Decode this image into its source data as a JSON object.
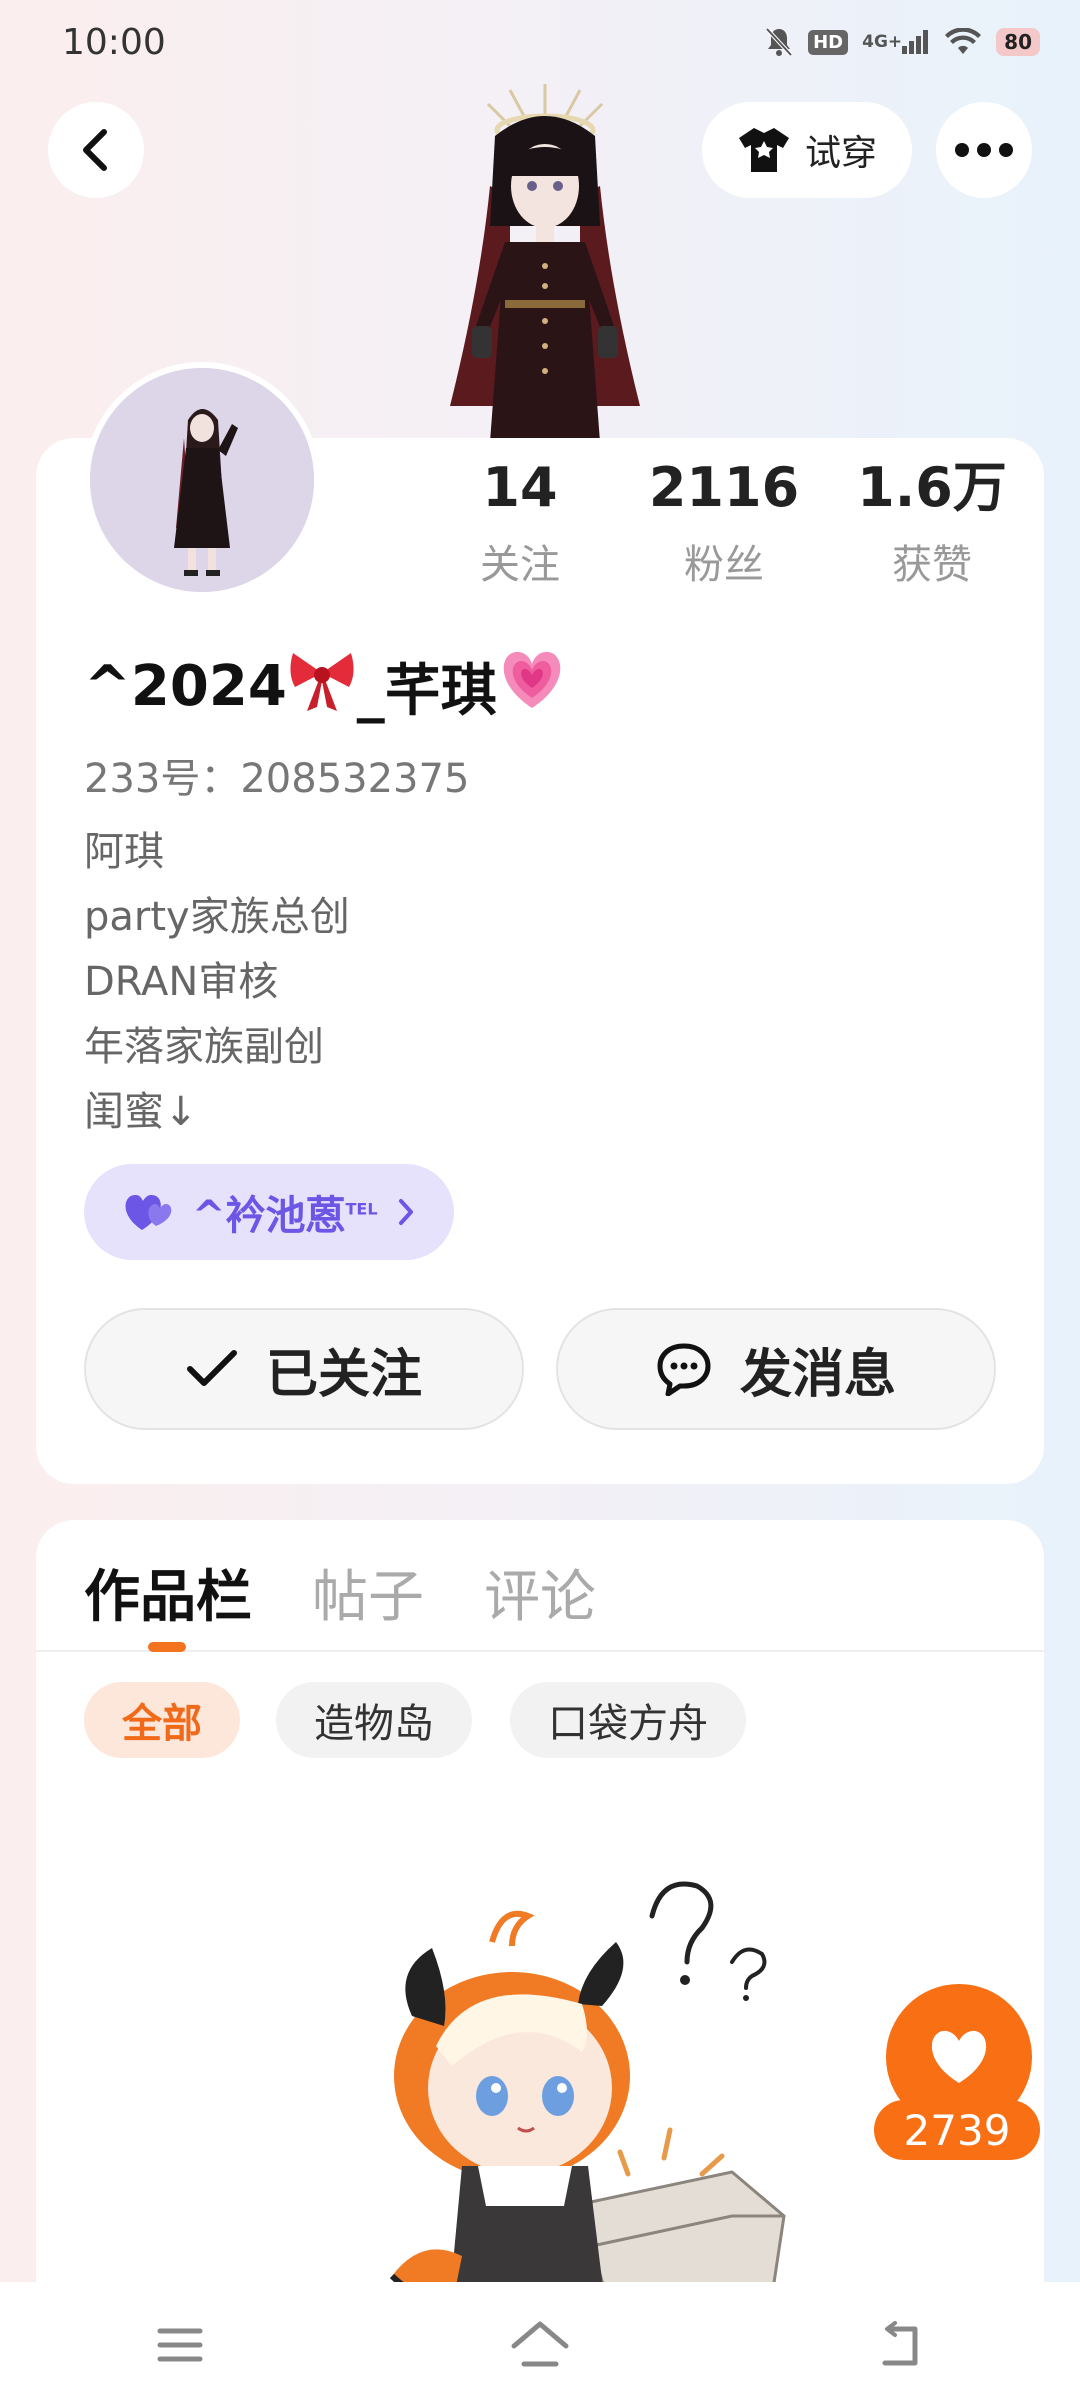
{
  "status_bar": {
    "time": "10:00",
    "hd": "HD",
    "network": "4G+",
    "battery": "80"
  },
  "header": {
    "try_on_label": "试穿"
  },
  "stats": [
    {
      "value": "14",
      "label": "关注"
    },
    {
      "value": "2116",
      "label": "粉丝"
    },
    {
      "value": "1.6万",
      "label": "获赞"
    }
  ],
  "profile": {
    "nickname_part1": "^2024",
    "nickname_part2": "_芊琪",
    "uid": "233号：208532375",
    "bio_lines": [
      "阿琪",
      "party家族总创",
      "DRAN审核",
      "年落家族副创",
      "闺蜜↓"
    ],
    "partner_name": "^衿池蒽",
    "partner_tag": "TEL"
  },
  "actions": {
    "follow_label": "已关注",
    "message_label": "发消息"
  },
  "tabs": [
    {
      "label": "作品栏",
      "active": true
    },
    {
      "label": "帖子",
      "active": false
    },
    {
      "label": "评论",
      "active": false
    }
  ],
  "chips": [
    {
      "label": "全部",
      "active": true
    },
    {
      "label": "造物岛",
      "active": false
    },
    {
      "label": "口袋方舟",
      "active": false
    }
  ],
  "like_fab": {
    "count": "2739"
  },
  "colors": {
    "accent": "#f86f14",
    "partner_purple": "#6b56e6"
  }
}
